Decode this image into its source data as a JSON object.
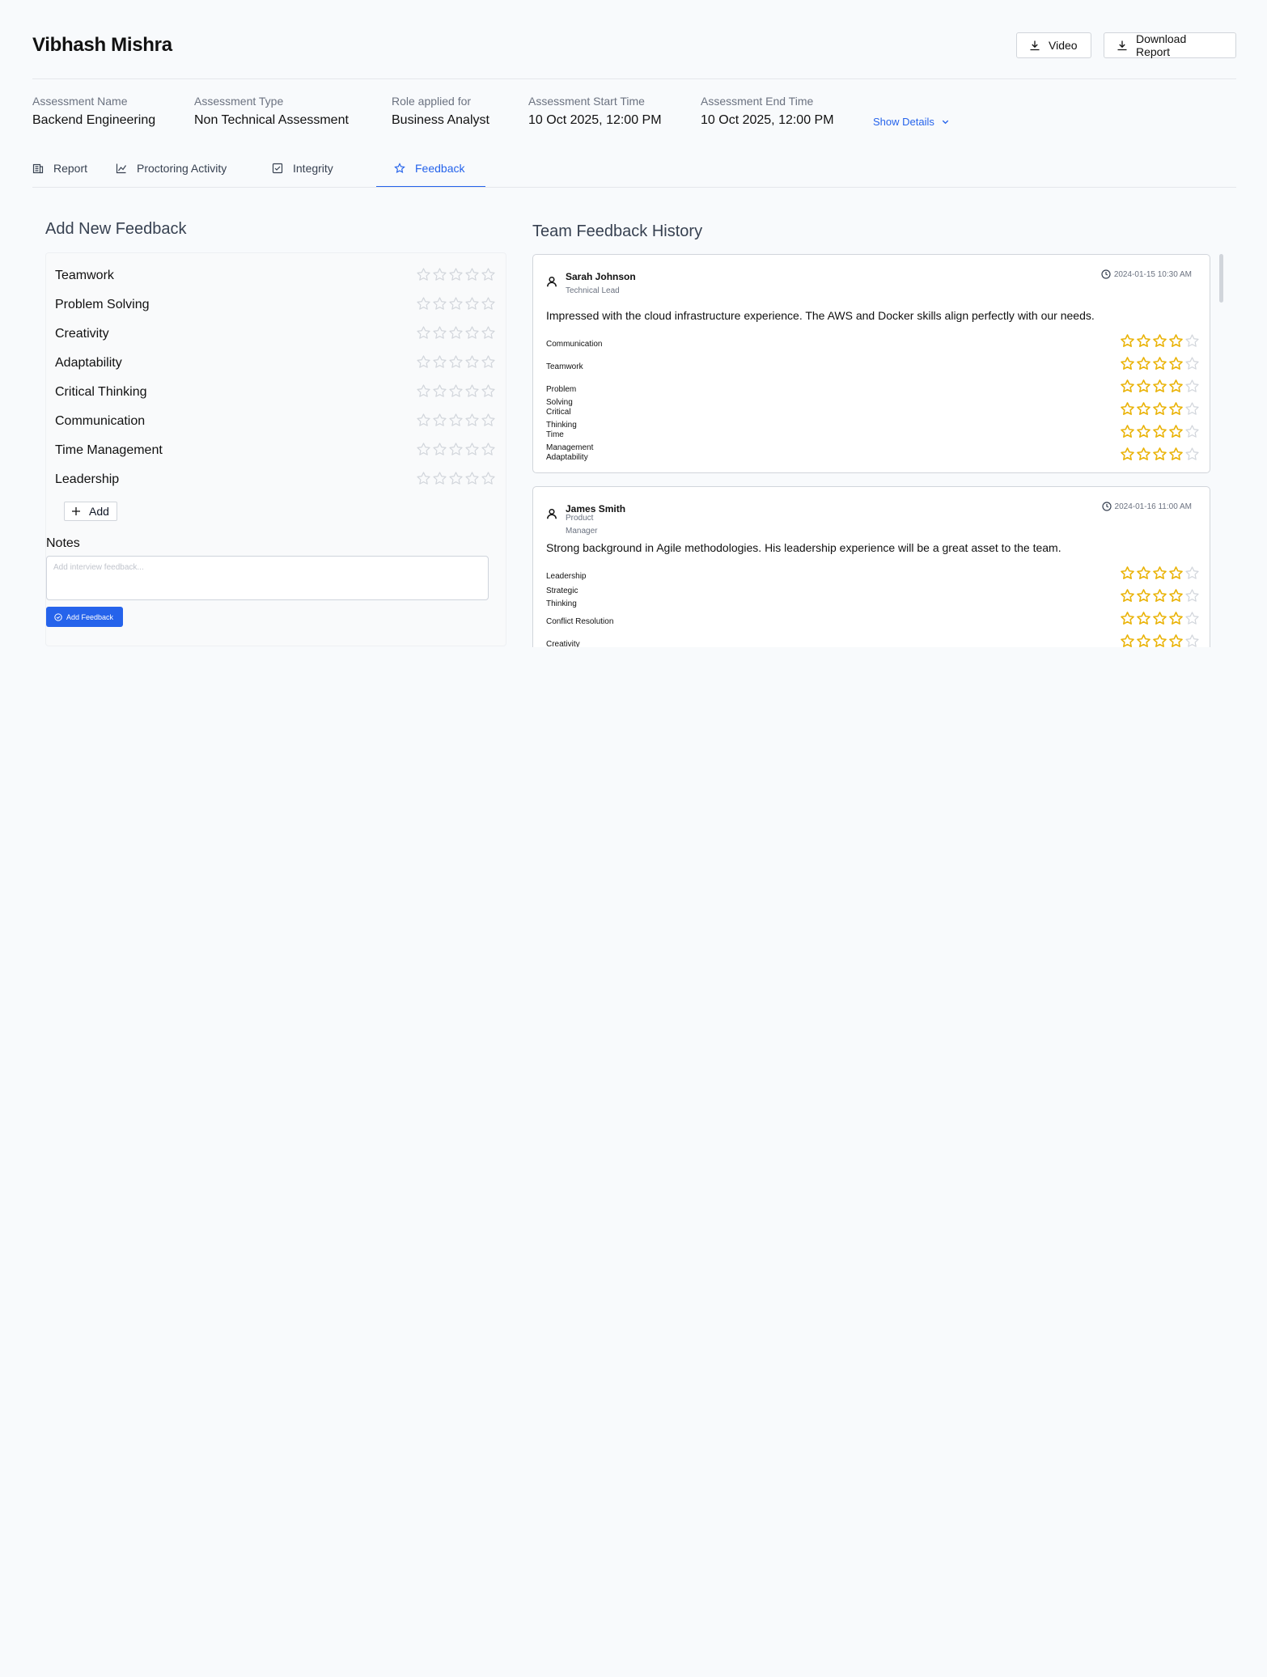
{
  "header": {
    "candidate_name": "Vibhash Mishra",
    "video_label": "Video",
    "download_report_label": "Download Report"
  },
  "meta": {
    "assessment_name": {
      "label": "Assessment Name",
      "value": "Backend Engineering"
    },
    "assessment_type": {
      "label": "Assessment Type",
      "value": "Non Technical Assessment"
    },
    "role": {
      "label": "Role applied for",
      "value": "Business Analyst"
    },
    "start_time": {
      "label": "Assessment Start Time",
      "value": "10 Oct 2025, 12:00 PM"
    },
    "end_time": {
      "label": "Assessment End Time",
      "value": "10 Oct 2025, 12:00 PM"
    },
    "show_details_label": "Show Details"
  },
  "tabs": {
    "report": "Report",
    "proctoring": "Proctoring Activity",
    "integrity": "Integrity",
    "feedback": "Feedback",
    "active": "feedback"
  },
  "add_feedback": {
    "title": "Add New Feedback",
    "criteria": [
      "Teamwork",
      "Problem Solving",
      "Creativity",
      "Adaptability",
      "Critical Thinking",
      "Communication",
      "Time Management",
      "Leadership"
    ],
    "add_button_label": "Add",
    "notes_label": "Notes",
    "notes_placeholder": "Add interview feedback...",
    "submit_label": "Add Feedback"
  },
  "history": {
    "title": "Team Feedback History",
    "entries": [
      {
        "name": "Sarah Johnson",
        "role": "Technical Lead",
        "timestamp": "2024-01-15 10:30 AM",
        "comment": "Impressed with the cloud infrastructure experience. The AWS and Docker skills align perfectly with our needs.",
        "ratings": [
          {
            "label": "Communication",
            "value": 4
          },
          {
            "label": "Teamwork",
            "value": 4
          },
          {
            "label": "Problem Solving",
            "value": 4
          },
          {
            "label": "Critical Thinking",
            "value": 4
          },
          {
            "label": "Time Management",
            "value": 4
          },
          {
            "label": "Adaptability",
            "value": 4
          }
        ]
      },
      {
        "name": "James Smith",
        "role": "Product Manager",
        "timestamp": "2024-01-16 11:00 AM",
        "comment": "Strong background in Agile methodologies. His leadership experience will be a great asset to the team.",
        "ratings": [
          {
            "label": "Leadership",
            "value": 4
          },
          {
            "label": "Strategic Thinking",
            "value": 4
          },
          {
            "label": "Conflict Resolution",
            "value": 4
          },
          {
            "label": "Creativity",
            "value": 4
          }
        ]
      }
    ],
    "max_stars": 5
  },
  "colors": {
    "accent": "#2563eb",
    "star_filled": "#eab308",
    "star_empty": "#d1d5db"
  }
}
